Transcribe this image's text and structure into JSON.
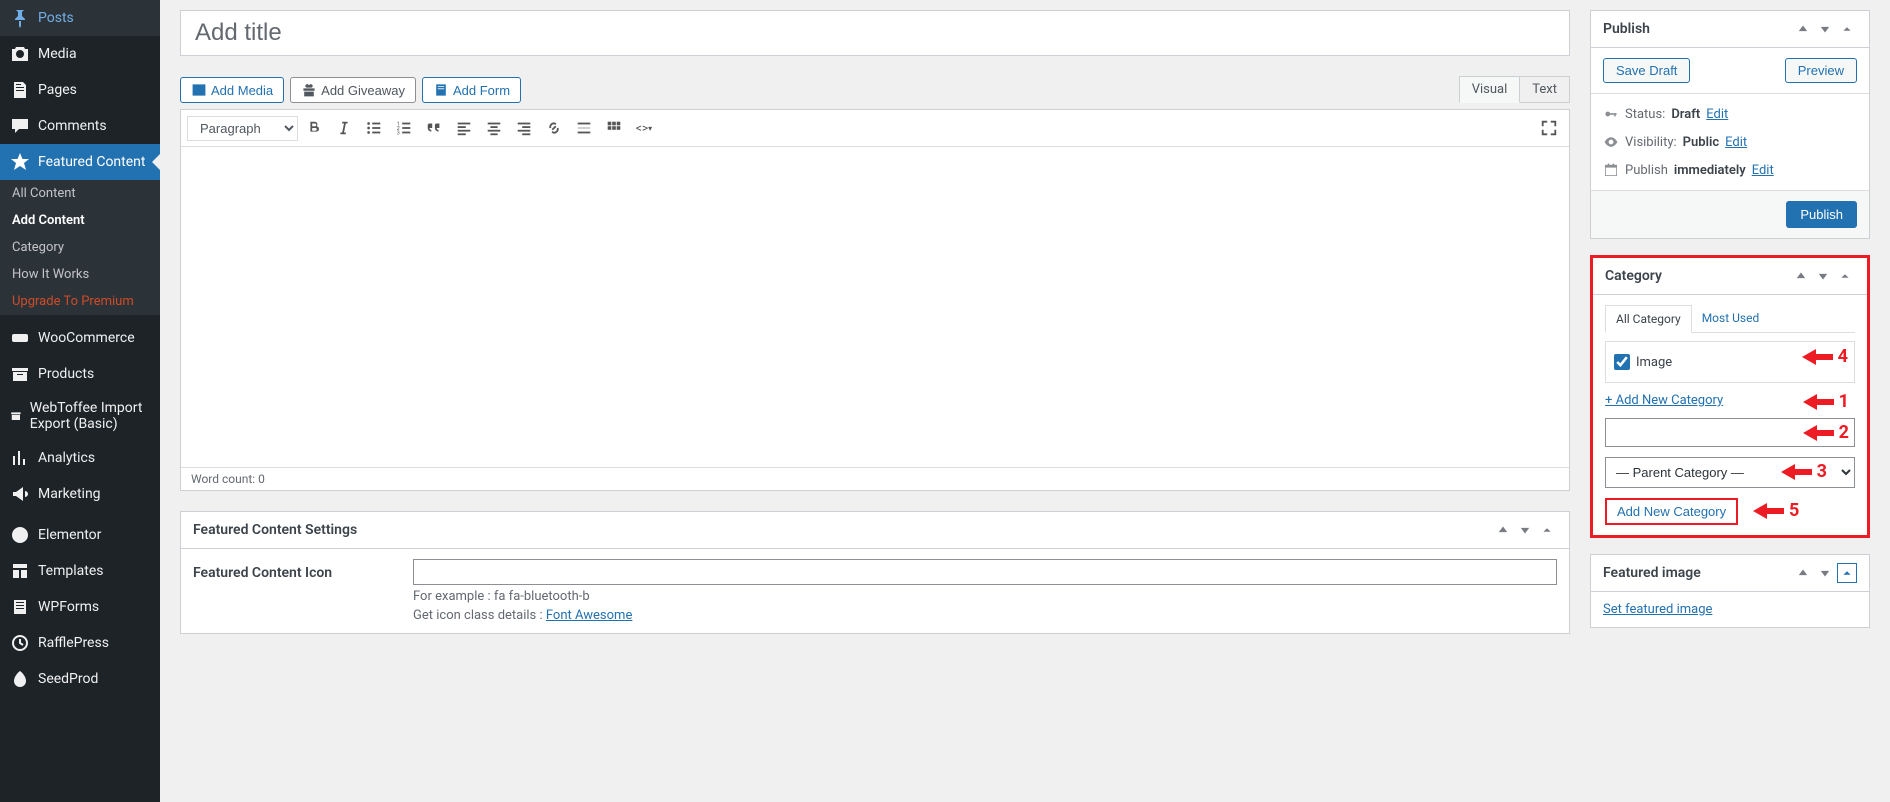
{
  "sidebar": {
    "items": [
      {
        "label": "Posts",
        "icon": "pin"
      },
      {
        "label": "Media",
        "icon": "camera"
      },
      {
        "label": "Pages",
        "icon": "page"
      },
      {
        "label": "Comments",
        "icon": "comment"
      },
      {
        "label": "Featured Content",
        "icon": "star",
        "active": true,
        "submenu": [
          {
            "label": "All Content"
          },
          {
            "label": "Add Content",
            "active": true
          },
          {
            "label": "Category"
          },
          {
            "label": "How It Works"
          },
          {
            "label": "Upgrade To Premium",
            "upgrade": true
          }
        ]
      },
      {
        "label": "WooCommerce",
        "icon": "woo"
      },
      {
        "label": "Products",
        "icon": "archive"
      },
      {
        "label": "WebToffee Import Export (Basic)",
        "icon": "archive"
      },
      {
        "label": "Analytics",
        "icon": "chart"
      },
      {
        "label": "Marketing",
        "icon": "megaphone"
      },
      {
        "label": "Elementor",
        "icon": "elementor"
      },
      {
        "label": "Templates",
        "icon": "templates"
      },
      {
        "label": "WPForms",
        "icon": "form"
      },
      {
        "label": "RafflePress",
        "icon": "raffle"
      },
      {
        "label": "SeedProd",
        "icon": "seed"
      }
    ]
  },
  "editor": {
    "title_placeholder": "Add title",
    "buttons": {
      "add_media": "Add Media",
      "add_giveaway": "Add Giveaway",
      "add_form": "Add Form"
    },
    "tabs": {
      "visual": "Visual",
      "text": "Text"
    },
    "format_label": "Paragraph",
    "word_count": "Word count: 0"
  },
  "fc_settings": {
    "panel_title": "Featured Content Settings",
    "icon_label": "Featured Content Icon",
    "icon_value": "",
    "hint1": "For example : fa fa-bluetooth-b",
    "hint2_prefix": "Get icon class details : ",
    "hint2_link": "Font Awesome"
  },
  "publish": {
    "title": "Publish",
    "save_draft": "Save Draft",
    "preview": "Preview",
    "status_label": "Status:",
    "status_value": "Draft",
    "status_edit": "Edit",
    "visibility_label": "Visibility:",
    "visibility_value": "Public",
    "visibility_edit": "Edit",
    "publish_label": "Publish",
    "publish_value": "immediately",
    "publish_edit": "Edit",
    "submit": "Publish"
  },
  "category": {
    "title": "Category",
    "tabs": {
      "all": "All Category",
      "most": "Most Used"
    },
    "items": [
      {
        "label": "Image",
        "checked": true
      }
    ],
    "add_link": "+ Add New Category",
    "new_cat_value": "",
    "parent_placeholder": "— Parent Category —",
    "add_button": "Add New Category"
  },
  "featured_image": {
    "title": "Featured image",
    "set_link": "Set featured image"
  },
  "annotations": {
    "a1": "1",
    "a2": "2",
    "a3": "3",
    "a4": "4",
    "a5": "5"
  }
}
